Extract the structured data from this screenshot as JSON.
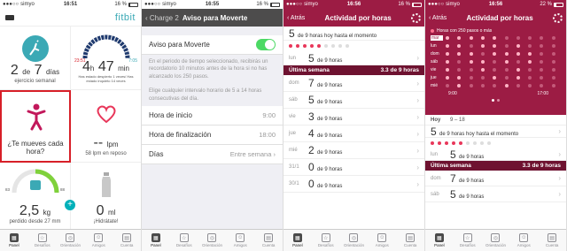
{
  "status": {
    "p1": {
      "carrier": "simyo",
      "time": "16:51",
      "battery": "16 %"
    },
    "p2": {
      "carrier": "simyo",
      "time": "16:55",
      "battery": "16 %"
    },
    "p3": {
      "carrier": "simyo",
      "time": "16:56",
      "battery": "16 %"
    },
    "p4": {
      "carrier": "simyo",
      "time": "16:56",
      "battery": "22 %"
    }
  },
  "p1": {
    "logo": "fitbit",
    "tiles": {
      "exercise": {
        "value": "2",
        "sep": "de",
        "goal": "7",
        "unit": "días",
        "label": "ejercicio semanal"
      },
      "sleep": {
        "hours": "4",
        "minutes": "47",
        "unit_h": "h",
        "unit_m": "min",
        "start": "23:51",
        "end": "7:05",
        "note": "Has estado despierto 1 veces/ Has estado inquieto 14 veces"
      },
      "move": {
        "label": "¿Te mueves cada hora?"
      },
      "heart": {
        "value": "--",
        "unit": "lpm",
        "label": "58 lpm en reposo"
      },
      "weight": {
        "value": "2,5",
        "unit": "kg",
        "label": "perdido desde 27 mm",
        "min": "83",
        "max": "88"
      },
      "water": {
        "value": "0",
        "unit": "ml",
        "label": "¡Hidrátate!"
      }
    }
  },
  "tabs": [
    {
      "label": "Panel",
      "icon": "dashboard-icon"
    },
    {
      "label": "Desafíos",
      "icon": "star-icon"
    },
    {
      "label": "Orientación",
      "icon": "compass-icon"
    },
    {
      "label": "Amigos",
      "icon": "people-icon"
    },
    {
      "label": "Cuenta",
      "icon": "account-icon"
    }
  ],
  "p2": {
    "back": "Charge 2",
    "title": "Aviso para Moverte",
    "toggle_label": "Aviso para Moverte",
    "desc1": "En el periodo de tiempo seleccionado, recibirás un recordatorio 10 minutos antes de la hora si no has alcanzado los 250 pasos.",
    "desc2": "Elige cualquier intervalo horario de 5 a 14 horas consecutivas del día.",
    "start_label": "Hora de inicio",
    "start_value": "9:00",
    "end_label": "Hora de finalización",
    "end_value": "18:00",
    "days_label": "Días",
    "days_value": "Entre semana"
  },
  "p3": {
    "back": "Atrás",
    "title": "Actividad por horas",
    "today": {
      "value": "5",
      "rest": "de 9 horas hoy hasta el momento"
    },
    "lun": {
      "day": "lun",
      "value": "5",
      "rest": "de 9 horas"
    },
    "week_label": "Última semana",
    "week_value": "3.3 de 9 horas",
    "rows": [
      {
        "day": "dom",
        "value": "7",
        "rest": "de 9 horas"
      },
      {
        "day": "sáb",
        "value": "5",
        "rest": "de 9 horas"
      },
      {
        "day": "vie",
        "value": "3",
        "rest": "de 9 horas"
      },
      {
        "day": "jue",
        "value": "4",
        "rest": "de 9 horas"
      },
      {
        "day": "mié",
        "value": "2",
        "rest": "de 9 horas"
      },
      {
        "day": "31/1",
        "value": "0",
        "rest": "de 9 horas"
      },
      {
        "day": "30/1",
        "value": "0",
        "rest": "de 9 horas"
      }
    ]
  },
  "p4": {
    "back": "Atrás",
    "title": "Actividad por horas",
    "legend": "Horas con 250 pasos o más",
    "days": [
      "mar",
      "lun",
      "dom",
      "sáb",
      "vie",
      "jue",
      "mié"
    ],
    "time_start": "9:00",
    "time_end": "17:00",
    "today_label": "Hoy",
    "range": "9 – 18",
    "today": {
      "value": "5",
      "rest": "de 9 horas hoy hasta el momento"
    },
    "lun": {
      "day": "lun",
      "value": "5",
      "rest": "de 9 horas"
    },
    "week_label": "Última semana",
    "week_value": "3.3 de 9 horas",
    "rows": [
      {
        "day": "dom",
        "value": "7",
        "rest": "de 9 horas"
      },
      {
        "day": "sáb",
        "value": "5",
        "rest": "de 9 horas"
      }
    ]
  }
}
